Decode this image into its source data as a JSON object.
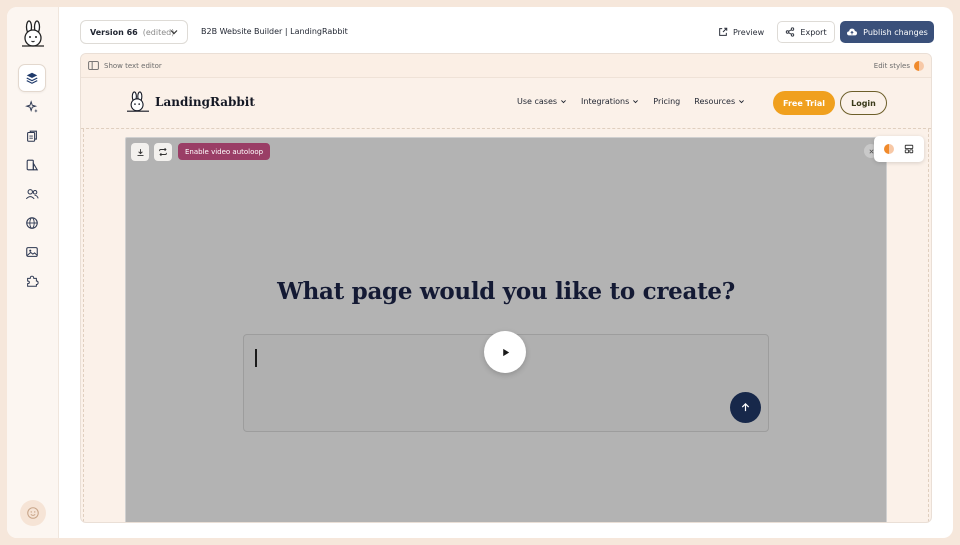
{
  "header": {
    "version_label": "Version 66",
    "version_status": "(edited)",
    "site_title": "B2B Website Builder | LandingRabbit",
    "preview_label": "Preview",
    "export_label": "Export",
    "publish_label": "Publish changes"
  },
  "sidebar": {
    "items": [
      {
        "icon": "layers-icon",
        "active": true
      },
      {
        "icon": "sparkles-icon",
        "active": false
      },
      {
        "icon": "pages-icon",
        "active": false
      },
      {
        "icon": "shapes-icon",
        "active": false
      },
      {
        "icon": "users-icon",
        "active": false
      },
      {
        "icon": "globe-icon",
        "active": false
      },
      {
        "icon": "image-icon",
        "active": false
      },
      {
        "icon": "puzzle-icon",
        "active": false
      }
    ],
    "avatar_icon": "smile-icon"
  },
  "editor": {
    "show_text_editor_label": "Show text editor",
    "edit_styles_label": "Edit styles"
  },
  "site": {
    "brand": "LandingRabbit",
    "nav": [
      "Use cases",
      "Integrations",
      "Pricing",
      "Resources"
    ],
    "free_trial_label": "Free Trial",
    "login_label": "Login"
  },
  "hero": {
    "autoloop_label": "Enable video autoloop",
    "title": "What page would you like to create?",
    "prompt_value": ""
  },
  "colors": {
    "accent_orange": "#f0a01e",
    "publish_blue": "#3a507a",
    "autoloop_magenta": "#9a3e66",
    "send_navy": "#17284a"
  }
}
